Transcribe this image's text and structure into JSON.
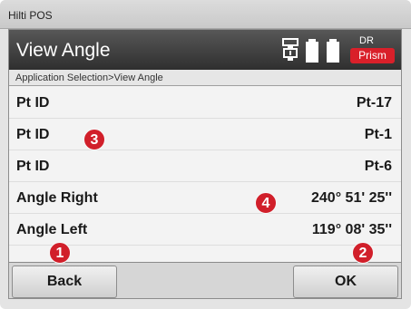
{
  "window": {
    "title": "Hilti POS"
  },
  "header": {
    "title": "View Angle",
    "status_top": "DR",
    "status_badge": "Prism",
    "icons": [
      "instrument-icon",
      "battery-icon"
    ]
  },
  "breadcrumb": "Application Selection>View Angle",
  "rows": [
    {
      "label": "Pt ID",
      "value": "Pt-17"
    },
    {
      "label": "Pt ID",
      "value": "Pt-1"
    },
    {
      "label": "Pt ID",
      "value": "Pt-6"
    },
    {
      "label": "Angle Right",
      "value": "240° 51' 25''"
    },
    {
      "label": "Angle Left",
      "value": "119° 08' 35''"
    }
  ],
  "softkeys": {
    "back": "Back",
    "ok": "OK"
  },
  "callouts": [
    "1",
    "2",
    "3",
    "4"
  ],
  "colors": {
    "header": "#3b3b3b",
    "badge": "#d9202a",
    "callout": "#d11f2a"
  }
}
